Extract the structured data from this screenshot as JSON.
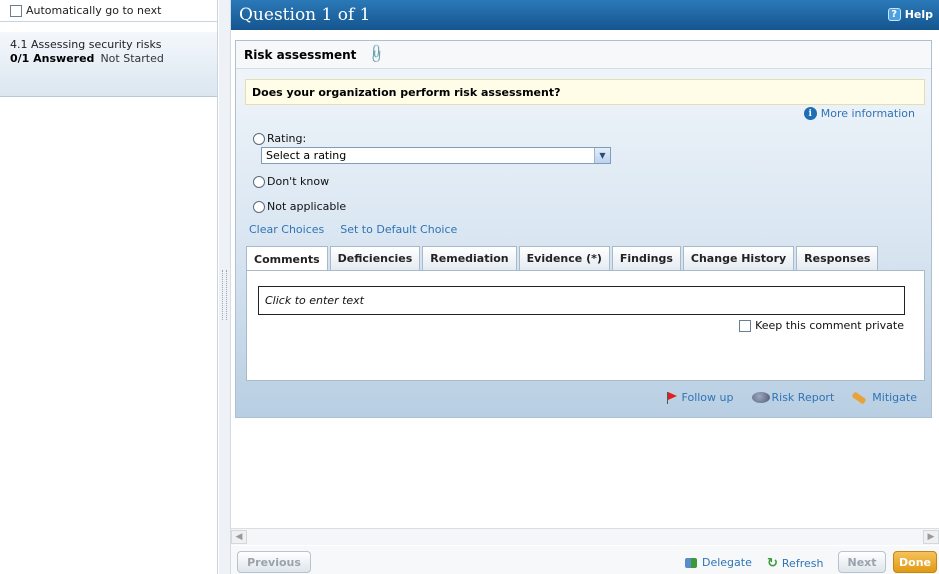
{
  "left": {
    "auto_next_label": "Automatically go to next",
    "item_title": "4.1 Assessing security risks",
    "item_progress": "0/1 Answered",
    "item_status": "Not Started"
  },
  "header": {
    "title": "Question 1 of 1",
    "help_label": "Help"
  },
  "question": {
    "section_title": "Risk assessment",
    "text": "Does your organization perform risk assessment?",
    "more_info": "More information",
    "options": {
      "rating_label": "Rating:",
      "rating_select_value": "Select a rating",
      "dont_know": "Don't know",
      "not_applicable": "Not applicable"
    },
    "links": {
      "clear": "Clear Choices",
      "default": "Set to Default Choice"
    }
  },
  "tabs": [
    {
      "label": "Comments"
    },
    {
      "label": "Deficiencies"
    },
    {
      "label": "Remediation"
    },
    {
      "label": "Evidence (*)"
    },
    {
      "label": "Findings"
    },
    {
      "label": "Change History"
    },
    {
      "label": "Responses"
    }
  ],
  "comments": {
    "placeholder": "Click to enter text",
    "private_label": "Keep this comment private"
  },
  "actions": {
    "follow_up": "Follow up",
    "risk_report": "Risk Report",
    "mitigate": "Mitigate"
  },
  "bottom": {
    "previous": "Previous",
    "delegate": "Delegate",
    "refresh": "Refresh",
    "next": "Next",
    "done": "Done"
  },
  "colors": {
    "header_blue": "#1f67a6",
    "link_blue": "#2f74b5",
    "done_orange": "#e8a529"
  }
}
